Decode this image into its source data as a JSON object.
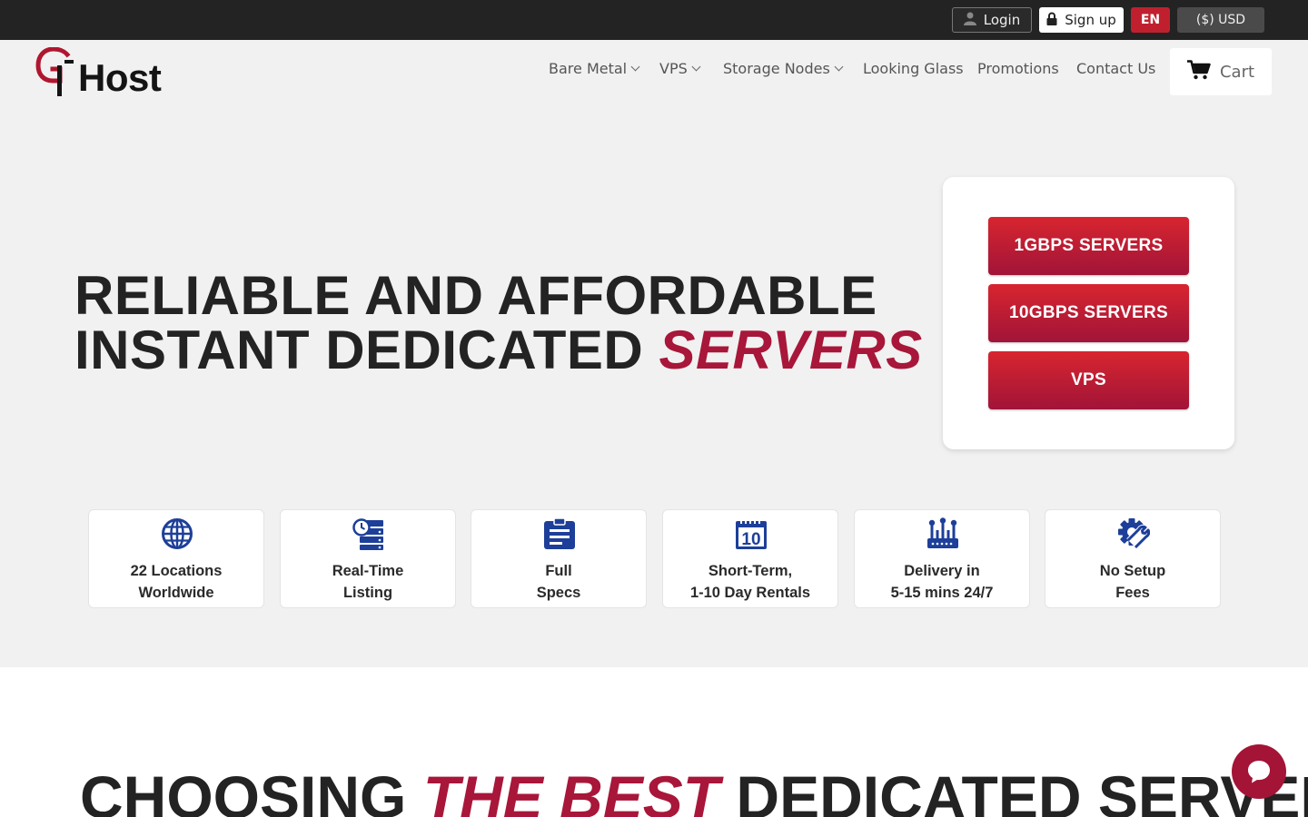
{
  "topbar": {
    "login_label": "Login",
    "signup_label": "Sign up",
    "language": "EN",
    "currency": "($) USD"
  },
  "logo": {
    "text": "Host"
  },
  "nav": {
    "items": [
      {
        "label": "Bare Metal",
        "dropdown": true
      },
      {
        "label": "VPS",
        "dropdown": true
      },
      {
        "label": "Storage Nodes",
        "dropdown": true
      },
      {
        "label": "Looking Glass",
        "dropdown": false
      },
      {
        "label": "Promotions",
        "dropdown": false
      },
      {
        "label": "Contact Us",
        "dropdown": false
      }
    ],
    "cart_label": "Cart"
  },
  "hero": {
    "line1": "RELIABLE AND AFFORDABLE",
    "line2_plain": "INSTANT DEDICATED",
    "line2_accent": "SERVERS",
    "buttons": [
      "1GBPS SERVERS",
      "10GBPS SERVERS",
      "VPS"
    ]
  },
  "features": [
    {
      "icon": "globe-icon",
      "text": "22 Locations\nWorldwide"
    },
    {
      "icon": "server-clock-icon",
      "text": "Real-Time\nListing"
    },
    {
      "icon": "clipboard-icon",
      "text": "Full\nSpecs"
    },
    {
      "icon": "calendar-icon",
      "text": "Short-Term,\n1-10 Day Rentals",
      "calendar_day": "10"
    },
    {
      "icon": "network-switch-icon",
      "text": "Delivery in\n5-15 mins 24/7"
    },
    {
      "icon": "gear-wrench-icon",
      "text": "No Setup\nFees"
    }
  ],
  "section": {
    "title_plain1": "CHOOSING",
    "title_accent": "THE BEST",
    "title_plain2": "DEDICATED SERVER"
  },
  "colors": {
    "brand_red": "#a8163a",
    "icon_blue": "#1d3f99",
    "topbar_bg": "#232323"
  }
}
